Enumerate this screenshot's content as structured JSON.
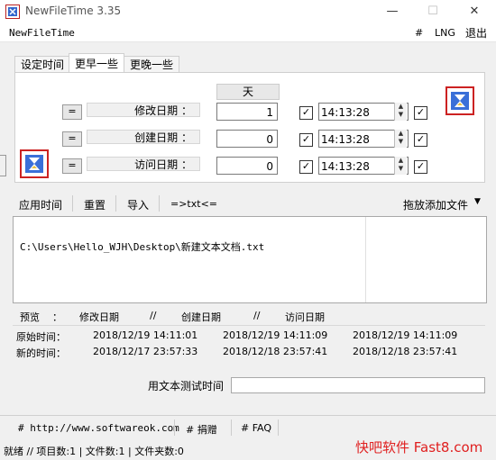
{
  "window": {
    "title": "NewFileTime 3.35",
    "controls": [
      "—",
      "☐",
      "✕"
    ]
  },
  "menu": {
    "app": "NewFileTime",
    "hash": "#",
    "lng": "LNG",
    "exit": "退出"
  },
  "tabs": [
    "设定时间",
    "更早一些",
    "更晚一些"
  ],
  "panel": {
    "day_header": "天",
    "rows": [
      {
        "eq": "=",
        "label": "修改日期 ：",
        "days": "1",
        "time": "14:13:28"
      },
      {
        "eq": "=",
        "label": "创建日期 ：",
        "days": "0",
        "time": "14:13:28"
      },
      {
        "eq": "=",
        "label": "访问日期 ：",
        "days": "0",
        "time": "14:13:28"
      }
    ]
  },
  "toolbar": {
    "apply": "应用时间",
    "reset": "重置",
    "import": "导入",
    "swap": "=>txt<=",
    "dragdrop": "拖放添加文件"
  },
  "files": [
    "C:\\Users\\Hello_WJH\\Desktop\\新建文本文档.txt"
  ],
  "preview": {
    "header": {
      "label": "预览",
      "colon": "：",
      "modified": "修改日期",
      "sep1": "//",
      "created": "创建日期",
      "sep2": "//",
      "accessed": "访问日期"
    },
    "original": {
      "label": "原始时间：",
      "modified": "2018/12/19 14:11:01",
      "created": "2018/12/19 14:11:09",
      "accessed": "2018/12/19 14:11:09"
    },
    "new": {
      "label": "新的时间：",
      "modified": "2018/12/17 23:57:33",
      "created": "2018/12/18 23:57:41",
      "accessed": "2018/12/18 23:57:41"
    }
  },
  "test": {
    "label": "用文本测试时间",
    "value": ""
  },
  "footer": {
    "site": "# http://www.softwareok.com",
    "donate": "# 捐赠",
    "faq": "# FAQ"
  },
  "status": "就绪 // 项目数:1 | 文件数:1 | 文件夹数:0",
  "watermark": "快吧软件 Fast8.com"
}
